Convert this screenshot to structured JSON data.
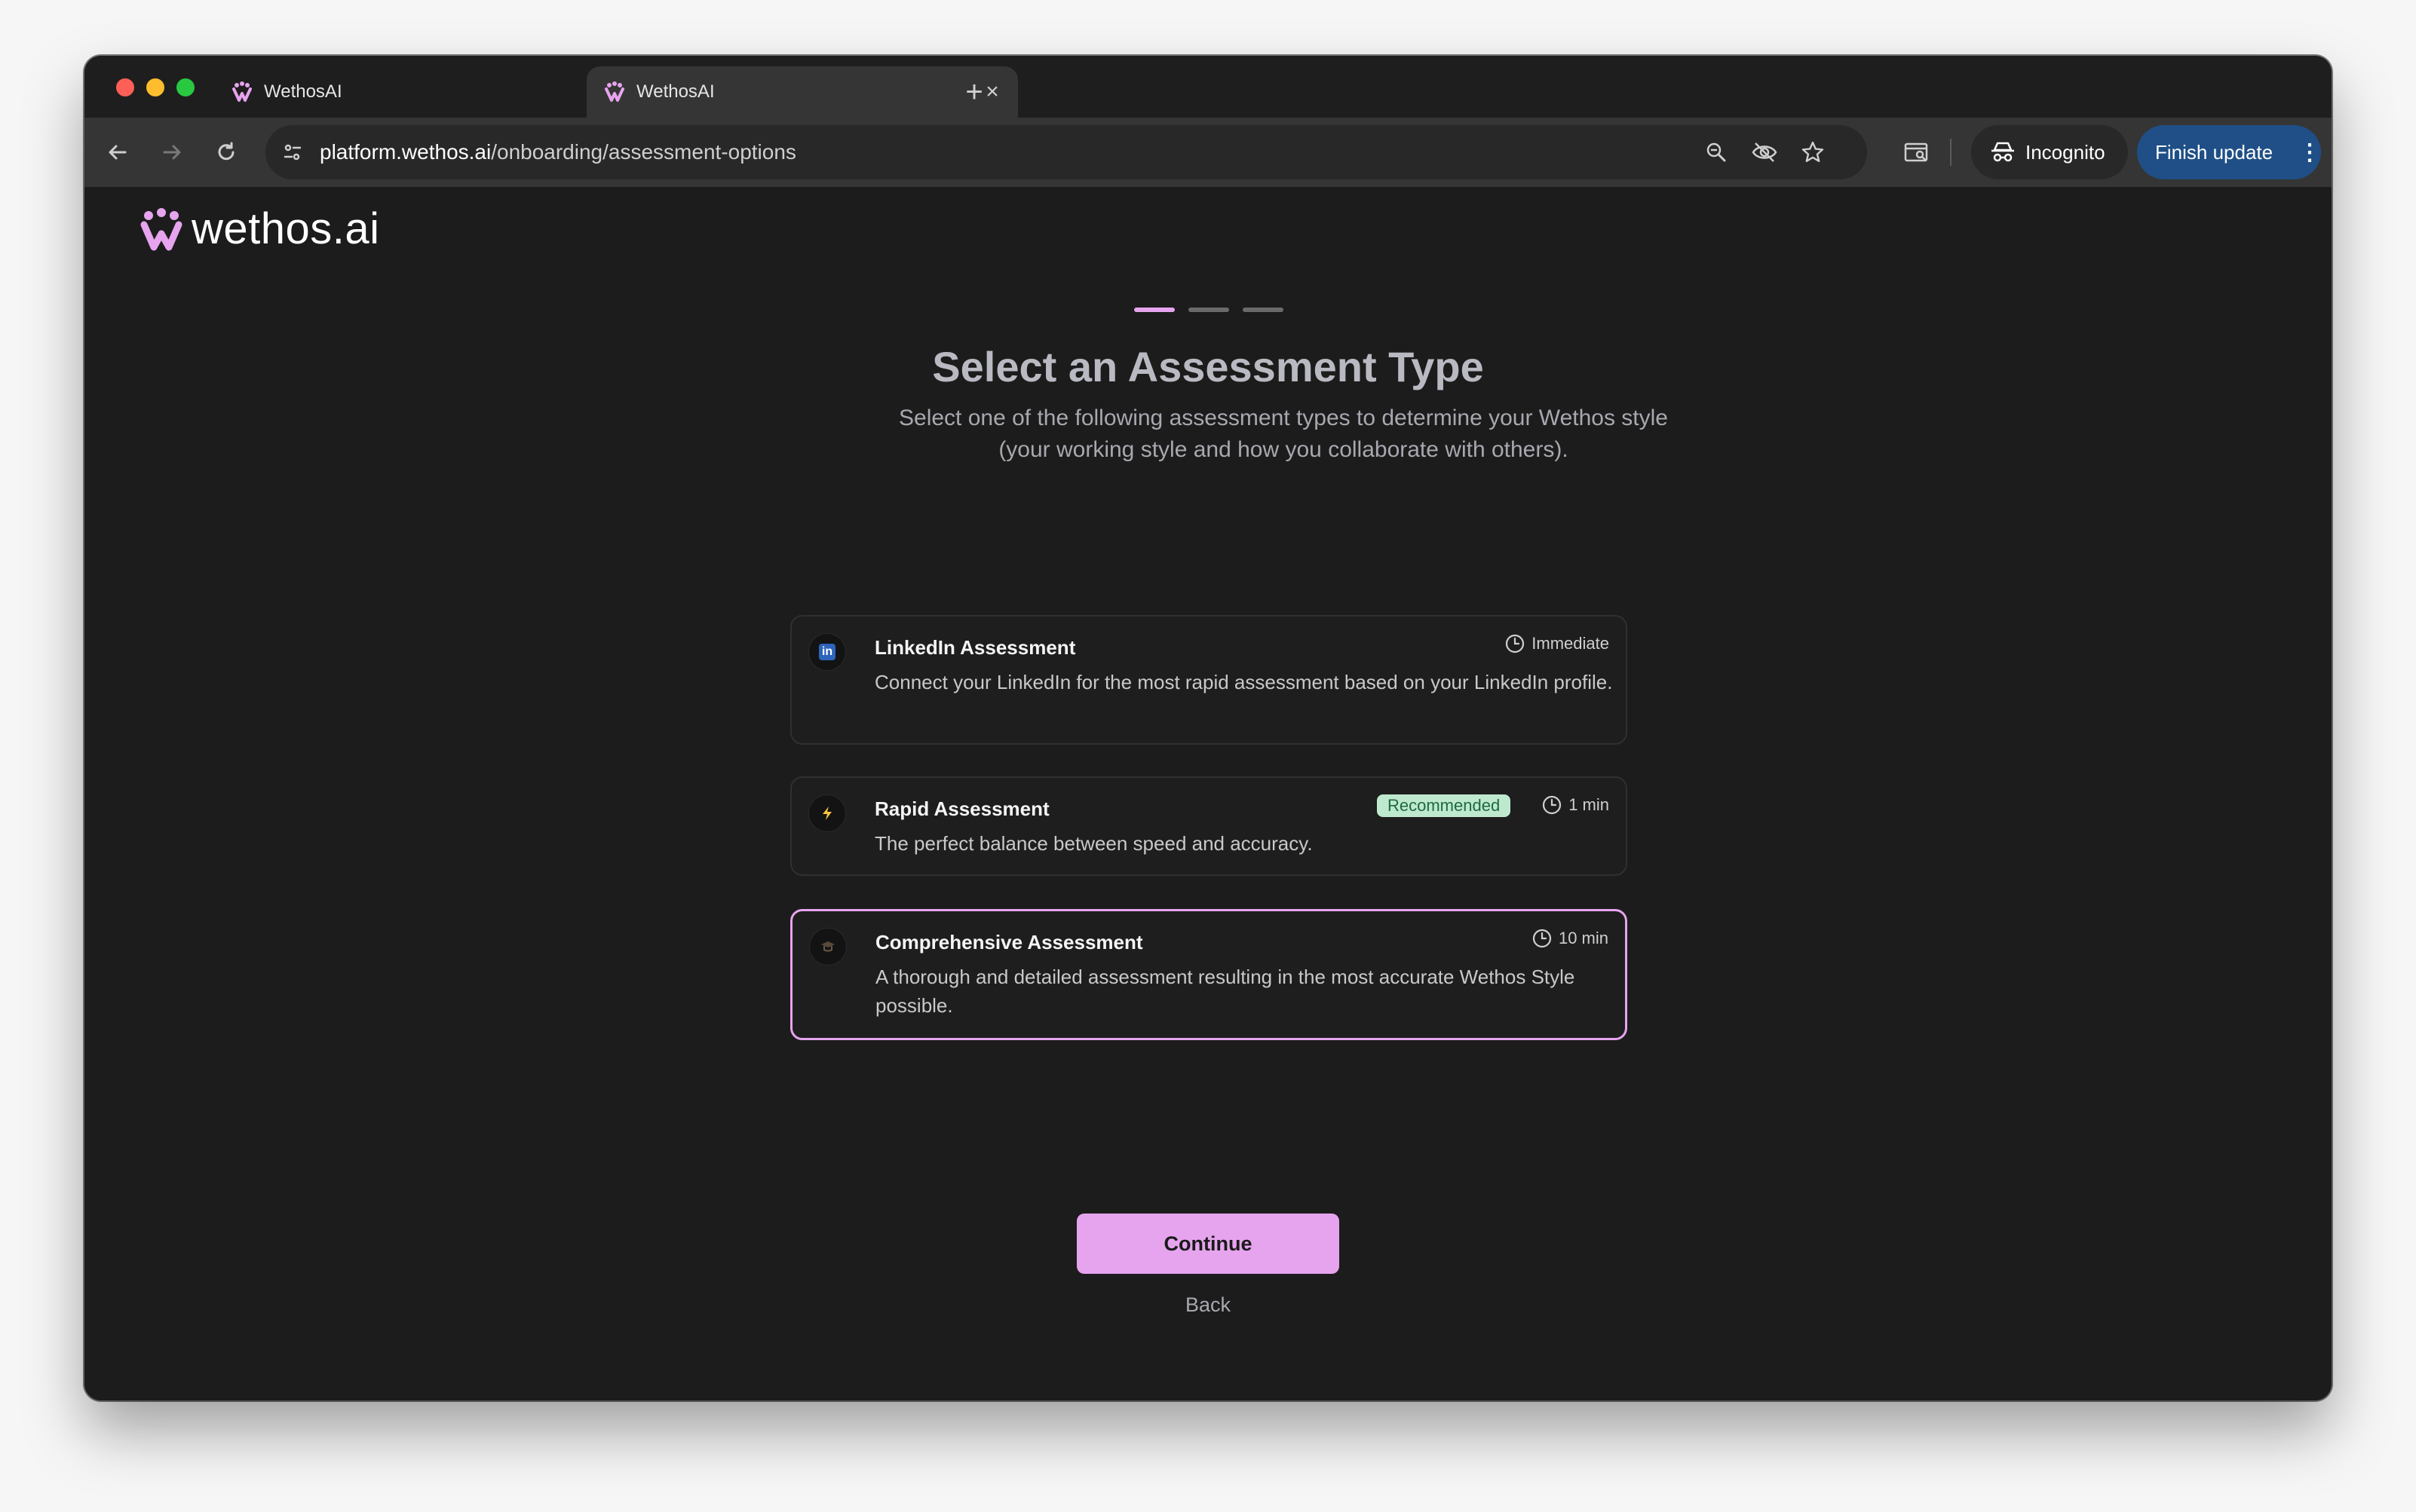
{
  "browser": {
    "tabs": [
      {
        "title": "WethosAI"
      },
      {
        "title": "WethosAI"
      }
    ],
    "address": {
      "host": "platform.wethos.ai",
      "path": "/onboarding/assessment-options"
    },
    "incognito_label": "Incognito",
    "finish_update_label": "Finish update"
  },
  "page": {
    "logo_text": "wethos.ai",
    "progress": {
      "total_steps": 3,
      "current_step": 1
    },
    "title": "Select an Assessment Type",
    "subtitle_line1": "Select one of the following assessment types to determine your Wethos style",
    "subtitle_line2": "(your working style and how you collaborate with others).",
    "options": [
      {
        "title": "LinkedIn Assessment",
        "time": "Immediate",
        "description": "Connect your LinkedIn for the most rapid assessment based on your LinkedIn profile.",
        "icon": "linkedin-icon",
        "icon_text": "in"
      },
      {
        "title": "Rapid Assessment",
        "time": "1 min",
        "badge": "Recommended",
        "description": "The perfect balance between speed and accuracy.",
        "icon": "lightning-icon"
      },
      {
        "title": "Comprehensive Assessment",
        "time": "10 min",
        "description": "A thorough and detailed assessment resulting in the most accurate Wethos Style possible.",
        "icon": "graduation-cap-icon",
        "selected": true
      }
    ],
    "continue_label": "Continue",
    "back_label": "Back"
  },
  "colors": {
    "accent": "#e6a4ee",
    "badge_bg": "#bfe9cf",
    "badge_text": "#1e6a3f",
    "finish_update": "#1f4f86"
  }
}
